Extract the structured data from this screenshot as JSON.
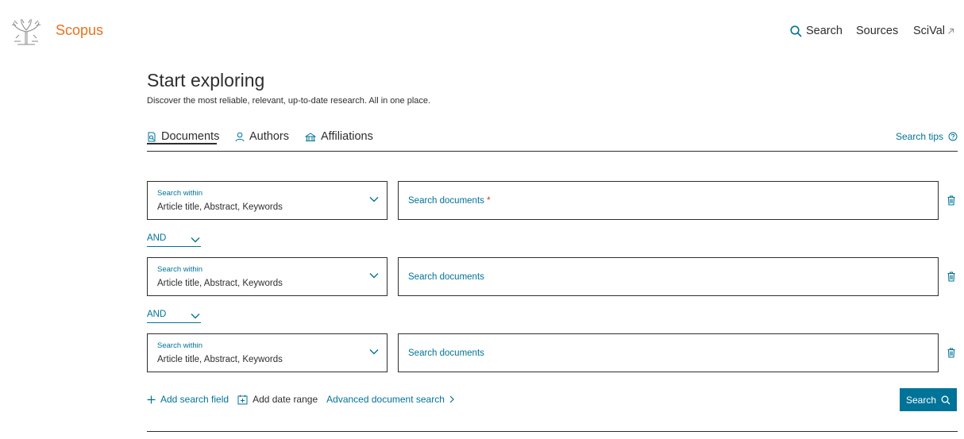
{
  "brand": {
    "name": "Scopus"
  },
  "topnav": {
    "search": "Search",
    "sources": "Sources",
    "scival": "SciVal"
  },
  "hero": {
    "title": "Start exploring",
    "subtitle": "Discover the most reliable, relevant, up-to-date research. All in one place."
  },
  "tabs": [
    {
      "label": "Documents",
      "icon": "document-search-icon",
      "active": true
    },
    {
      "label": "Authors",
      "icon": "person-icon",
      "active": false
    },
    {
      "label": "Affiliations",
      "icon": "building-icon",
      "active": false
    }
  ],
  "search_tips": "Search tips",
  "rows": [
    {
      "within_label": "Search within",
      "within_value": "Article title, Abstract, Keywords",
      "placeholder": "Search documents",
      "required": "*"
    },
    {
      "within_label": "Search within",
      "within_value": "Article title, Abstract, Keywords",
      "placeholder": "Search documents"
    },
    {
      "within_label": "Search within",
      "within_value": "Article title, Abstract, Keywords",
      "placeholder": "Search documents"
    }
  ],
  "operators": [
    "AND",
    "AND"
  ],
  "actions": {
    "add_field": "Add search field",
    "add_date": "Add date range",
    "advanced": "Advanced document search"
  },
  "search_button": "Search",
  "colors": {
    "accent": "#007398",
    "brand": "#e9711c",
    "text": "#2e2e2e",
    "required": "#c83727"
  }
}
